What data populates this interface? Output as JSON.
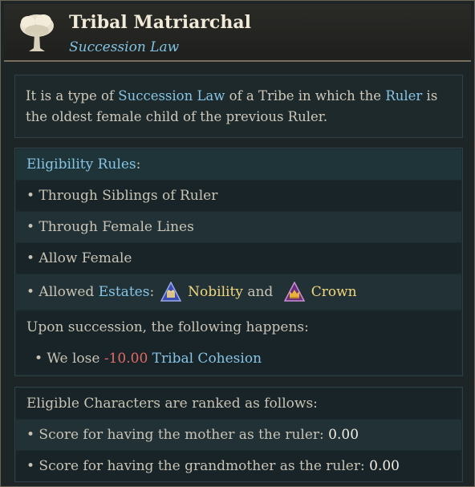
{
  "header": {
    "title": "Tribal Matriarchal",
    "subtitle": "Succession Law"
  },
  "description": {
    "t1": "It is a type of ",
    "link1": "Succession Law",
    "t2": " of a Tribe in which the ",
    "link2": "Ruler",
    "t3": " is the oldest female child of the previous Ruler."
  },
  "eligibility": {
    "heading_link": "Eligibility Rules",
    "heading_colon": ":",
    "rules": [
      "• Through Siblings of Ruler",
      "• Through Female Lines",
      "• Allow Female"
    ],
    "estates_prefix": "• Allowed ",
    "estates_link": "Estates",
    "estates_colon": ":",
    "estate1": "Nobility",
    "and_word": "and",
    "estate2": "Crown",
    "succession_text": "Upon succession, the following happens:",
    "effect_prefix": "• We lose ",
    "effect_value": "-10.00",
    "effect_link": "Tribal Cohesion"
  },
  "ranking": {
    "heading": "Eligible Characters are ranked as follows:",
    "items": [
      {
        "label": "• Score for having the mother as the ruler: ",
        "value": "0.00"
      },
      {
        "label": "• Score for having the grandmother as the ruler: ",
        "value": "0.00"
      }
    ]
  },
  "icons": {
    "header": "tree-icon",
    "estate1": "nobility-estate-icon",
    "estate2": "crown-estate-icon"
  },
  "colors": {
    "link": "#86c5e6",
    "gold": "#f2d77e",
    "negative": "#e56a67",
    "title": "#f1ead8"
  }
}
